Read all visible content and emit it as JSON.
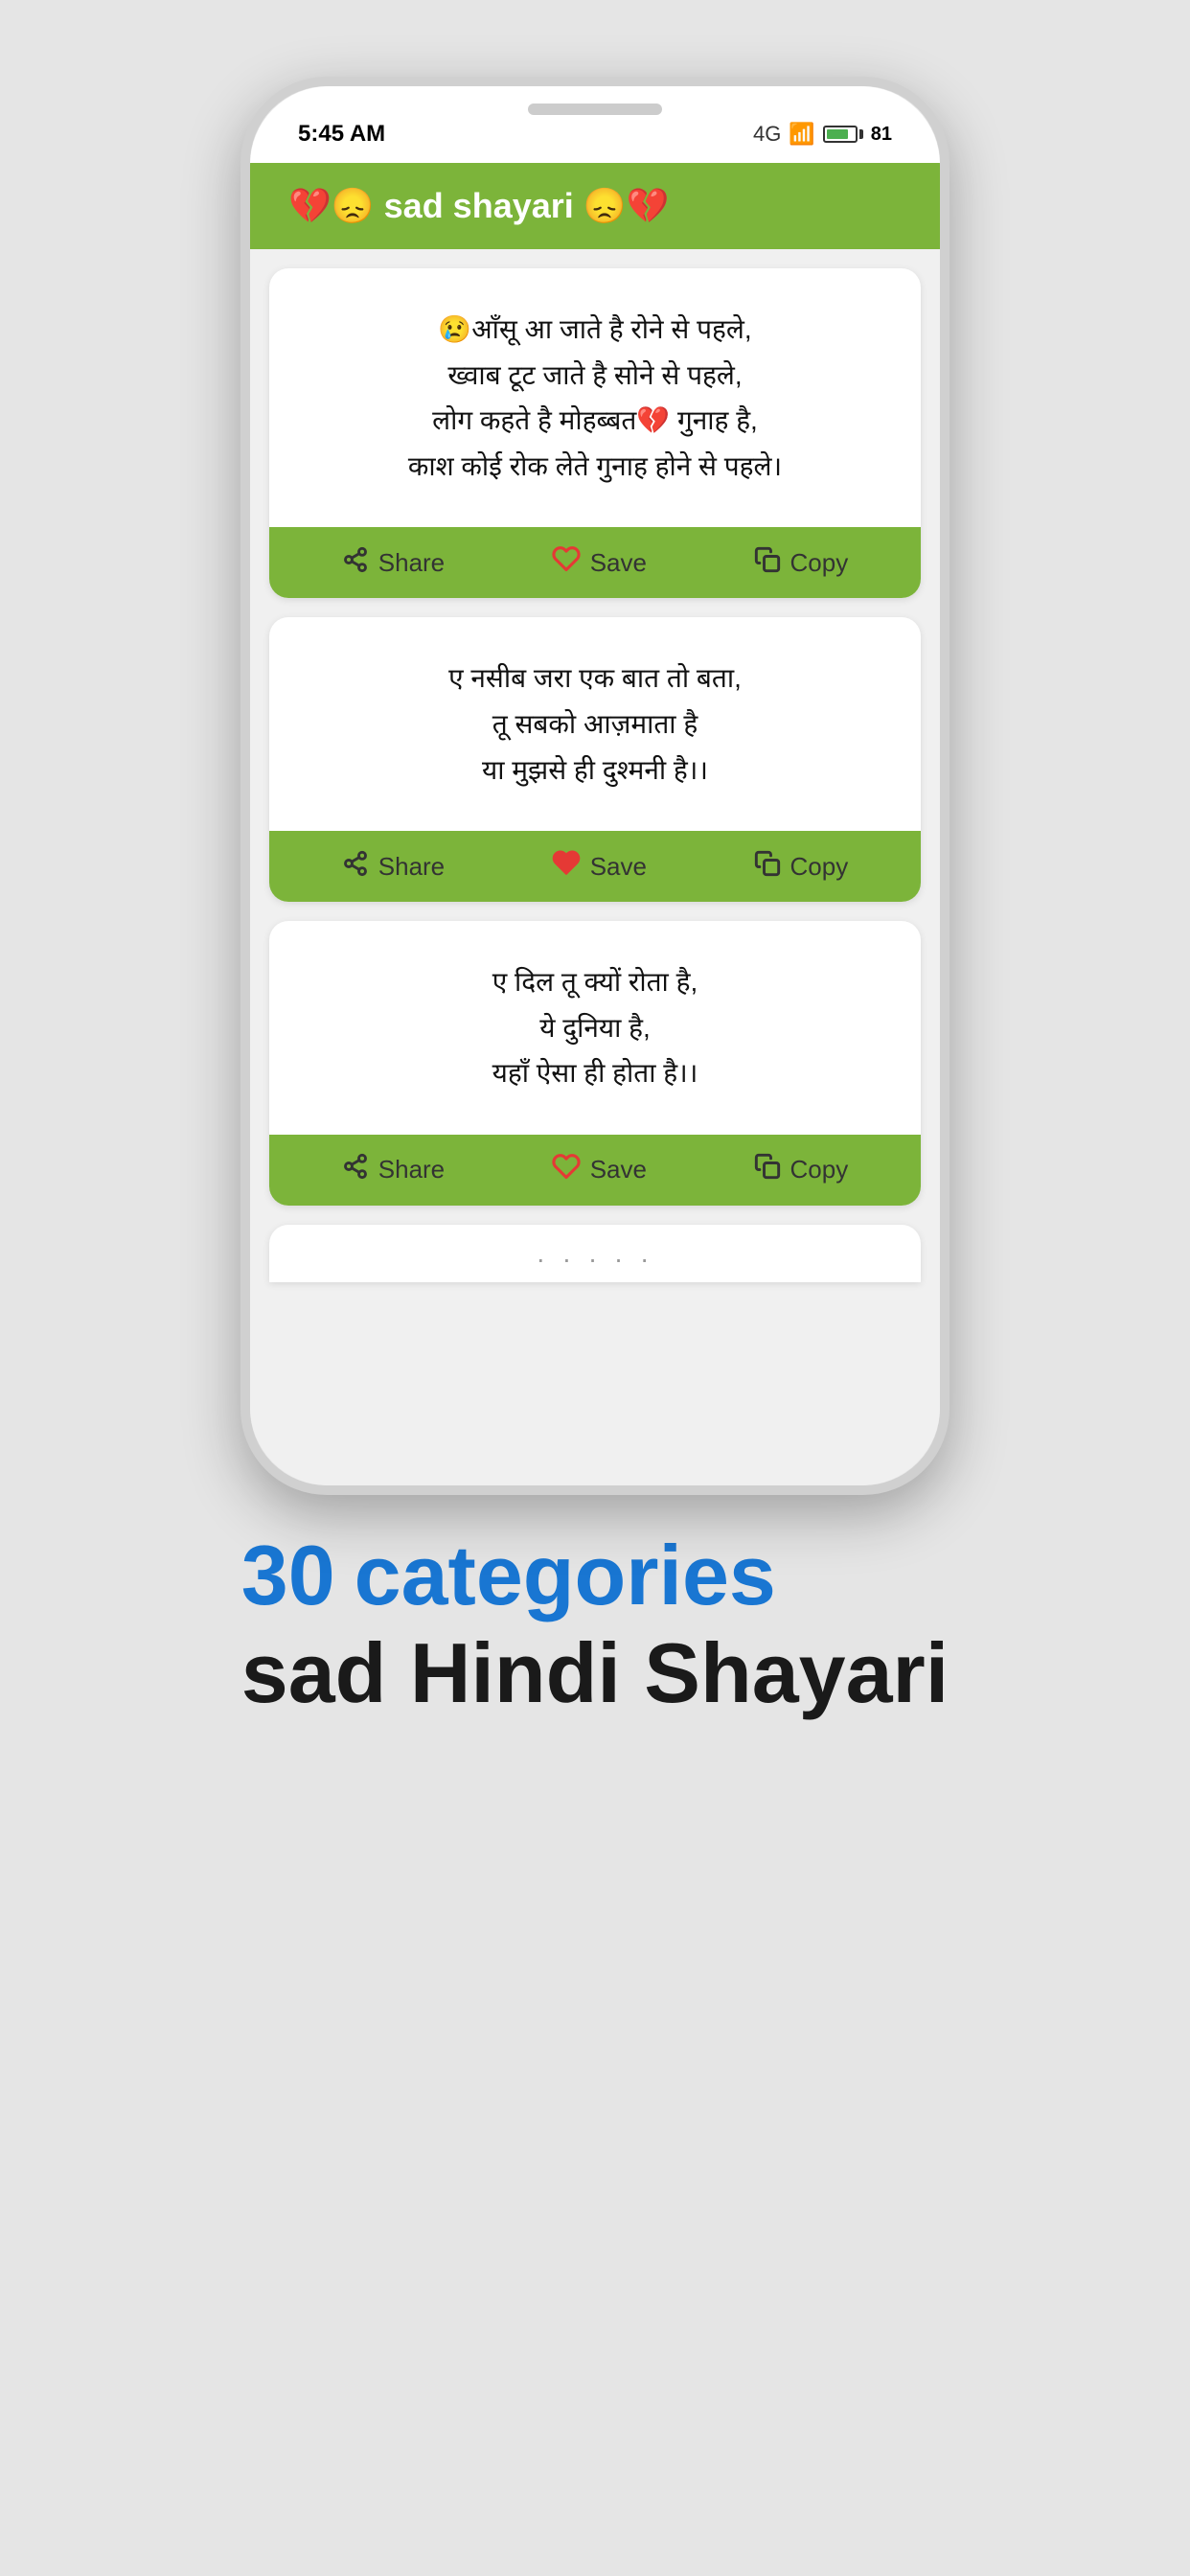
{
  "status_bar": {
    "time": "5:45 AM",
    "battery_percent": "81"
  },
  "header": {
    "title": "💔😞 sad shayari 😞💔"
  },
  "cards": [
    {
      "id": 1,
      "text": "😢आँसू आ जाते है रोने से पहले,\nख्वाब टूट जाते है सोने से पहले,\nलोग कहते है मोहब्बत💔 गुनाह है,\nकाश कोई रोक लेते गुनाह होने से पहले।",
      "heart_filled": false,
      "actions": {
        "share": "Share",
        "save": "Save",
        "copy": "Copy"
      }
    },
    {
      "id": 2,
      "text": "ए नसीब जरा एक बात तो बता,\nतू सबको आज़माता है\nया मुझसे ही दुश्मनी है।।",
      "heart_filled": true,
      "actions": {
        "share": "Share",
        "save": "Save",
        "copy": "Copy"
      }
    },
    {
      "id": 3,
      "text": "ए दिल तू क्यों रोता है,\nये दुनिया है,\nयहाँ ऐसा ही होता है।।",
      "heart_filled": false,
      "actions": {
        "share": "Share",
        "save": "Save",
        "copy": "Copy"
      }
    }
  ],
  "bottom": {
    "count": "30",
    "categories": "categories",
    "subtitle": "sad Hindi Shayari"
  },
  "icons": {
    "share": "share-icon",
    "heart_empty": "heart-outline-icon",
    "heart_filled": "heart-filled-icon",
    "copy": "copy-icon"
  }
}
